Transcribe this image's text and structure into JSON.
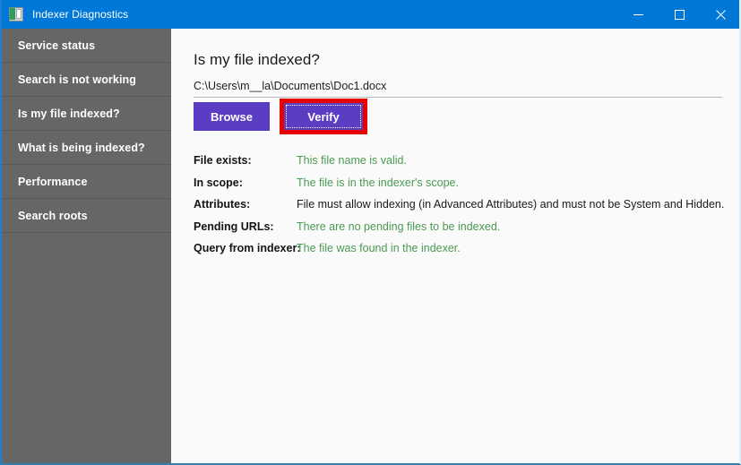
{
  "window": {
    "title": "Indexer Diagnostics",
    "icon": "indexer-app-icon",
    "titlebar_color": "#0078d7",
    "controls": [
      {
        "name": "minimize",
        "glyph": "minimize-icon"
      },
      {
        "name": "maximize",
        "glyph": "maximize-icon"
      },
      {
        "name": "close",
        "glyph": "close-icon"
      }
    ]
  },
  "sidebar": {
    "background": "#666666",
    "items": [
      {
        "label": "Service status"
      },
      {
        "label": "Search is not working"
      },
      {
        "label": "Is my file indexed?"
      },
      {
        "label": "What is being indexed?"
      },
      {
        "label": "Performance"
      },
      {
        "label": "Search roots"
      }
    ]
  },
  "main": {
    "title": "Is my file indexed?",
    "file_path": "C:\\Users\\m__la\\Documents\\Doc1.docx",
    "buttons": {
      "browse_label": "Browse",
      "verify_label": "Verify",
      "button_color": "#5b3dc4",
      "highlight_color": "#e60000"
    },
    "results": [
      {
        "label": "File exists:",
        "value": "This file name is valid.",
        "status": "ok"
      },
      {
        "label": "In scope:",
        "value": "The file is in the indexer's scope.",
        "status": "ok"
      },
      {
        "label": "Attributes:",
        "value": "File must allow indexing (in Advanced Attributes) and must not be System and Hidden.",
        "status": "info"
      },
      {
        "label": "Pending URLs:",
        "value": "There are no pending files to be indexed.",
        "status": "ok"
      },
      {
        "label": "Query from indexer:",
        "value": "The file was found in the indexer.",
        "status": "ok"
      }
    ],
    "status_colors": {
      "ok": "#4a9a52",
      "info": "#1a1a1a"
    }
  }
}
